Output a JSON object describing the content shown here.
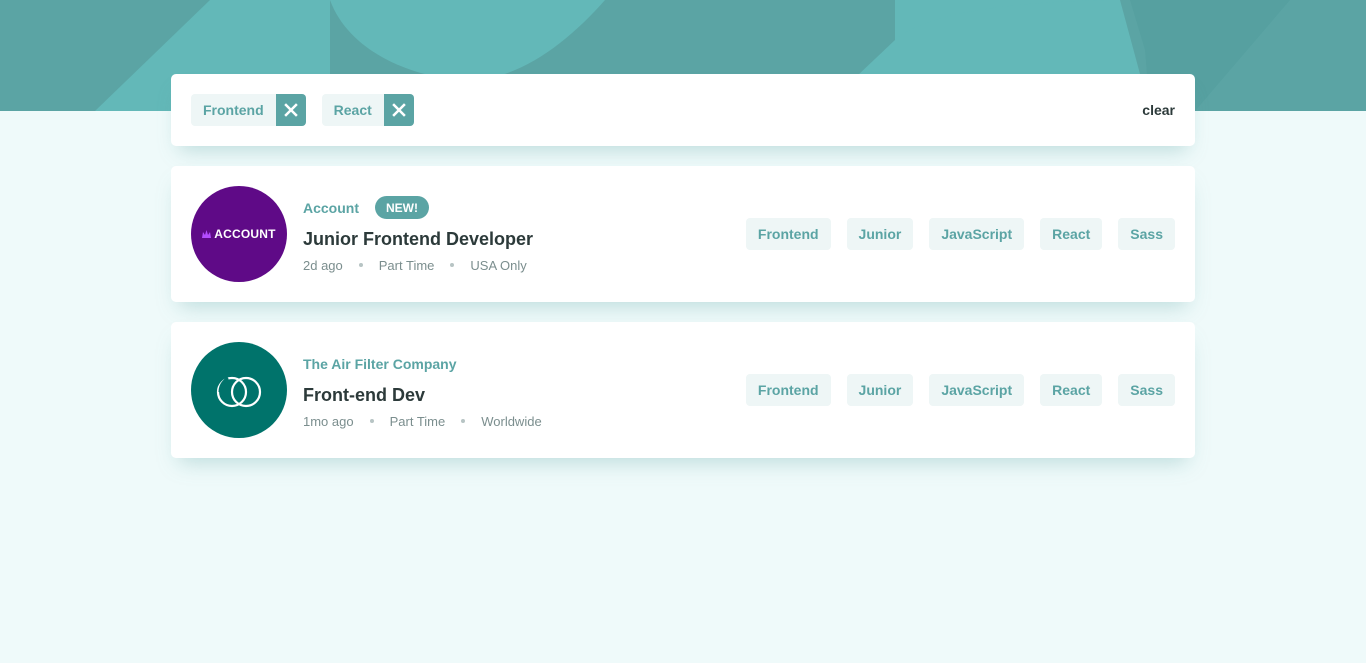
{
  "colors": {
    "primary": "#5ba4a4",
    "background": "#effafa",
    "tag_bg": "#eef6f6",
    "text_dark": "#2c3a3a",
    "text_muted": "#7b8e8e"
  },
  "filters": {
    "active": [
      {
        "label": "Frontend",
        "remove_icon": "close-icon"
      },
      {
        "label": "React",
        "remove_icon": "close-icon"
      }
    ],
    "clear_label": "clear"
  },
  "jobs": [
    {
      "company": "Account",
      "badge_new": "NEW!",
      "logo_text": "ACCOUNT",
      "position": "Junior Frontend Developer",
      "posted": "2d ago",
      "contract": "Part Time",
      "location": "USA Only",
      "tags": [
        "Frontend",
        "Junior",
        "JavaScript",
        "React",
        "Sass"
      ]
    },
    {
      "company": "The Air Filter Company",
      "position": "Front-end Dev",
      "posted": "1mo ago",
      "contract": "Part Time",
      "location": "Worldwide",
      "tags": [
        "Frontend",
        "Junior",
        "JavaScript",
        "React",
        "Sass"
      ]
    }
  ]
}
